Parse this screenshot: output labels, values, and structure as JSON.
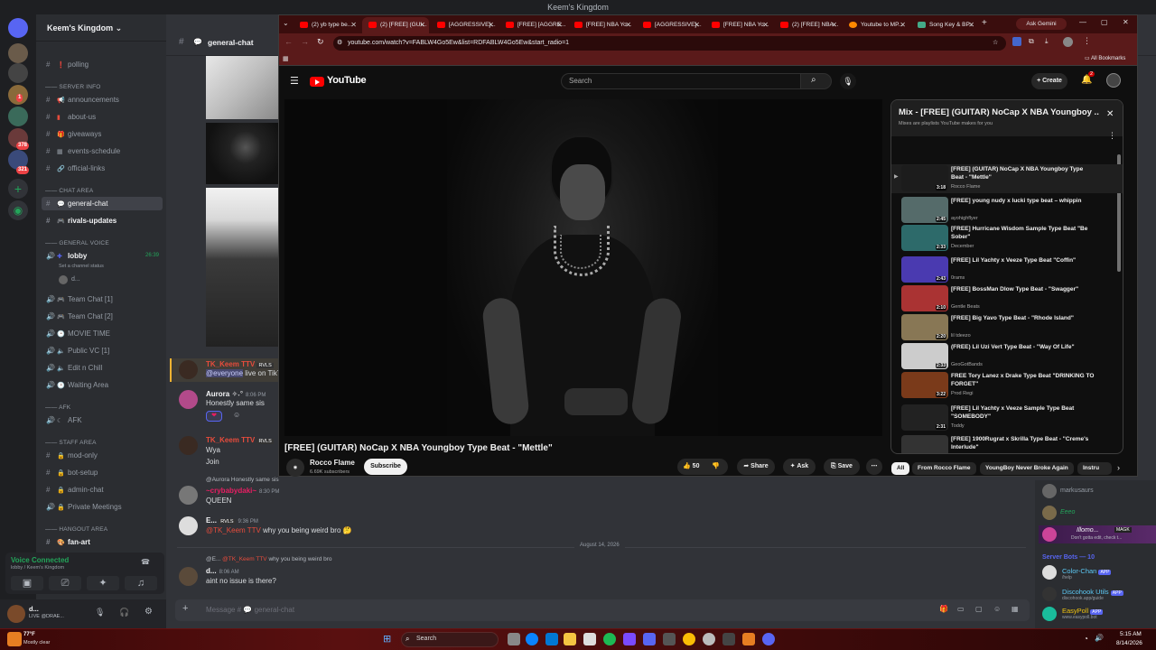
{
  "titlebar": {
    "text": "Keem's Kingdom"
  },
  "rail": {
    "badges": [
      "1",
      "378",
      "321"
    ]
  },
  "server": {
    "name": "Keem's Kingdom"
  },
  "channels": {
    "polling": "polling",
    "cat_server_info": "SERVER INFO",
    "announcements": "announcements",
    "about_us": "about-us",
    "giveaways": "giveaways",
    "events_schedule": "events-schedule",
    "official_links": "official-links",
    "cat_chat_area": "CHAT AREA",
    "general_chat": "general-chat",
    "rivals_updates": "rivals-updates",
    "cat_general_voice": "GENERAL VOICE",
    "lobby": "lobby",
    "lobby_time": "26:39",
    "lobby_status": "Set a channel status",
    "lobby_user": "d...",
    "team_chat_1": "Team Chat [1]",
    "team_chat_2": "Team Chat [2]",
    "movie_time": "MOVIE TIME",
    "public_vc": "Public VC [1]",
    "edit_n_chill": "Edit n Chill",
    "waiting_area": "Waiting Area",
    "cat_afk": "AFK",
    "afk": "AFK",
    "cat_staff_area": "STAFF AREA",
    "mod_only": "mod-only",
    "bot_setup": "bot-setup",
    "admin_chat": "admin-chat",
    "private_meetings": "Private Meetings",
    "cat_hangout_area": "HANGOUT AREA",
    "fan_art": "fan-art"
  },
  "voice": {
    "status": "Voice Connected",
    "location": "lobby / Keem's Kingdom"
  },
  "user": {
    "name": "d...",
    "status": "LIVE @DRAE..."
  },
  "header": {
    "channel": "general-chat"
  },
  "messages": {
    "m1_user": "TK_Keem TTV",
    "m1_tag": "RVLS",
    "m1_mention": "@everyone",
    "m1_text": "live on TikT",
    "m2_user": "Aurora",
    "m2_time": "8:06 PM",
    "m2_text": "Honestly same sis",
    "m3_user": "TK_Keem TTV",
    "m3_tag": "RVLS",
    "m3_text1": "Wya",
    "m3_text2": "Join",
    "m4_reply": "@Aurora  Honestly same sis",
    "m4_user": "~crybabydaki~",
    "m4_time": "8:30 PM",
    "m4_text": "QUEEN",
    "m5_user": "E...",
    "m5_tag": "RVLS",
    "m5_time": "9:36 PM",
    "m5_mention": "@TK_Keem TTV",
    "m5_text": "why you being weird bro",
    "date_divider": "August 14, 2026",
    "m6_reply_user": "@E...",
    "m6_reply_mention": "@TK_Keem TTV",
    "m6_reply_text": "why you being weird bro",
    "m6_user": "d...",
    "m6_time": "8:06 AM",
    "m6_text": "aint no issue is there?"
  },
  "composer": {
    "placeholder": "Message #",
    "channel": "general-chat"
  },
  "members": {
    "m_markusaurs": "markusaurs",
    "m_eeeo": "Eeeo",
    "m_illomo": "Illomo...",
    "m_illomo_tag": "MAGK",
    "m_illomo_status": "Don't gotta edit, check t...",
    "section": "Server Bots — 10",
    "bot1_name": "Color-Chan",
    "bot1_sub": "/help",
    "bot2_name": "Discohook Utils",
    "bot2_sub": "discohook.app/guide",
    "bot3_name": "EasyPoll",
    "bot3_sub": "www.easypoll.bot",
    "app_tag": "APP"
  },
  "taskbar": {
    "weather_temp": "77°F",
    "weather_desc": "Mostly clear",
    "search": "Search",
    "time": "5:15 AM",
    "date": "8/14/2026"
  },
  "browser": {
    "tabs": [
      "(2) yb type be...",
      "(2) [FREE] (GUI...",
      "[AGGRESSIVE]...",
      "[FREE] [AGGRE...",
      "[FREE] NBA Yo...",
      "[AGGRESSIVE]...",
      "[FREE] NBA Yo...",
      "(2) [FREE] NBA...",
      "Youtube to MP...",
      "Song Key & BP..."
    ],
    "ask_gemini": "Ask Gemini",
    "url": "youtube.com/watch?v=FABLW4Go5Ew&list=RDFABLW4Go5Ew&start_radio=1",
    "all_bookmarks": "All Bookmarks"
  },
  "youtube": {
    "logo": "YouTube",
    "search_placeholder": "Search",
    "create": "Create",
    "notif_count": "2",
    "video_title": "[FREE] (GUITAR) NoCap X NBA Youngboy Type Beat - \"Mettle\"",
    "channel": "Rocco Flame",
    "subscribers": "6.69K subscribers",
    "subscribe": "Subscribe",
    "likes": "50",
    "share": "Share",
    "ask": "Ask",
    "save": "Save",
    "playlist_title": "Mix - [FREE] (GUITAR) NoCap X NBA Youngboy ...",
    "playlist_sub": "Mixes are playlists YouTube makes for you",
    "items": [
      {
        "title": "[FREE] (GUITAR) NoCap X NBA Youngboy Type Beat - \"Mettle\"",
        "artist": "Rocco Flame",
        "dur": "3:18"
      },
      {
        "title": "[FREE] young nudy x lucki type beat – whippin",
        "artist": "ayohighflyer",
        "dur": "2:45"
      },
      {
        "title": "[FREE] Hurricane Wisdom Sample Type Beat \"Be Sober\"",
        "artist": "December",
        "dur": "2:33"
      },
      {
        "title": "[FREE] Lil Yachty x Veeze Type Beat \"Coffin\"",
        "artist": "0rams",
        "dur": "2:43"
      },
      {
        "title": "[FREE] BossMan Dlow Type Beat - \"Swagger\"",
        "artist": "Gentle Beats",
        "dur": "2:10"
      },
      {
        "title": "[FREE] Big Yavo Type Beat - \"Rhode Island\"",
        "artist": "lil tdeezo",
        "dur": "2:20"
      },
      {
        "title": "(FREE) Lil Uzi Vert Type Beat - \"Way Of Life\"",
        "artist": "GeoGotBands",
        "dur": "2:33"
      },
      {
        "title": "FREE Tory Lanez x Drake Type Beat \"DRINKING TO FORGET\"",
        "artist": "Prod Regi",
        "dur": "3:22"
      },
      {
        "title": "[FREE] Lil Yachty x Veeze Sample Type Beat \"SOMEBODY\"",
        "artist": "Toddy",
        "dur": "2:31"
      },
      {
        "title": "[FREE] 1900Rugrat x Skrilla Type Beat - \"Creme's Interlude\"",
        "artist": "WXCK Beats",
        "dur": "2:50"
      }
    ],
    "chips": [
      "All",
      "From Rocco Flame",
      "YoungBoy Never Broke Again",
      "Instru"
    ]
  },
  "colors": {
    "discord_bg": "#313338",
    "youtube_red": "#ff0000",
    "chrome_tab": "#5a1a1a"
  }
}
